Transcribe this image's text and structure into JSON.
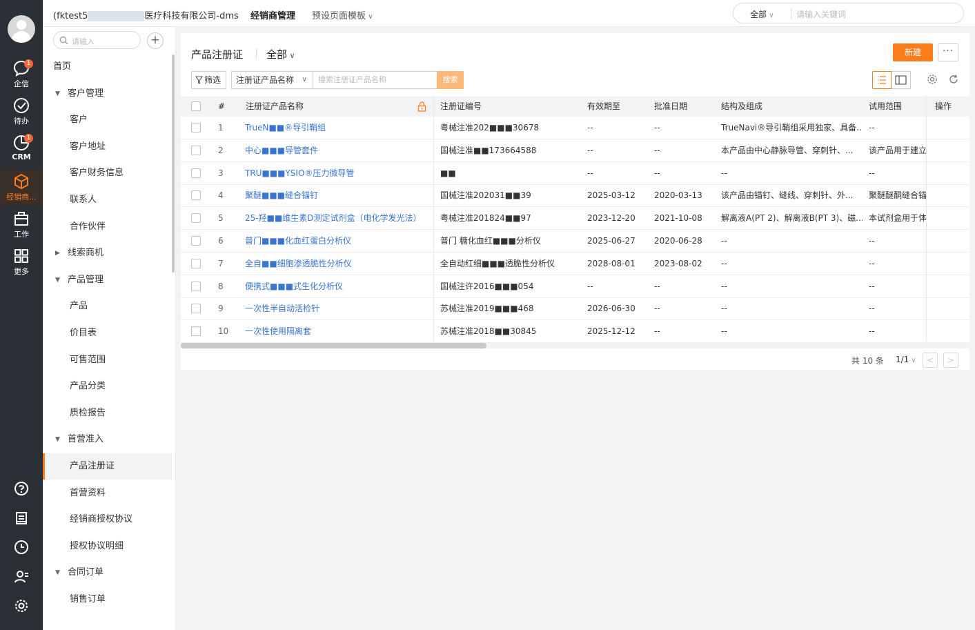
{
  "rail": {
    "items": [
      {
        "label": "企信",
        "badge": "1"
      },
      {
        "label": "待办",
        "badge": ""
      },
      {
        "label": "CRM",
        "badge": "1"
      },
      {
        "label": "经销商...",
        "badge": ""
      },
      {
        "label": "工作",
        "badge": ""
      },
      {
        "label": "更多",
        "badge": ""
      }
    ],
    "bottom_icons": [
      "help-icon",
      "report-icon",
      "clock-icon",
      "contacts-icon",
      "settings-icon"
    ]
  },
  "topbar": {
    "company_prefix": "(fktest5",
    "company_hidden": "■■■■■■",
    "company_suffix": "医疗科技有限公司-dms",
    "nav_active": "经销商管理",
    "nav_template": "预设页面模板",
    "search_scope": "全部",
    "search_placeholder": "请输入关键词"
  },
  "sidebar": {
    "search_placeholder": "请输入",
    "add_label": "+",
    "items": [
      {
        "label": "首页",
        "level": 0
      },
      {
        "label": "客户管理",
        "level": 1,
        "caret": "▼"
      },
      {
        "label": "客户",
        "level": 2
      },
      {
        "label": "客户地址",
        "level": 2
      },
      {
        "label": "客户财务信息",
        "level": 2
      },
      {
        "label": "联系人",
        "level": 2
      },
      {
        "label": "合作伙伴",
        "level": 2
      },
      {
        "label": "线索商机",
        "level": 1,
        "caret": "▶"
      },
      {
        "label": "产品管理",
        "level": 1,
        "caret": "▼"
      },
      {
        "label": "产品",
        "level": 2
      },
      {
        "label": "价目表",
        "level": 2
      },
      {
        "label": "可售范围",
        "level": 2
      },
      {
        "label": "产品分类",
        "level": 2
      },
      {
        "label": "质检报告",
        "level": 2
      },
      {
        "label": "首营准入",
        "level": 1,
        "caret": "▼"
      },
      {
        "label": "产品注册证",
        "level": 2,
        "active": true
      },
      {
        "label": "首营资料",
        "level": 2
      },
      {
        "label": "经销商授权协议",
        "level": 2
      },
      {
        "label": "授权协议明细",
        "level": 2
      },
      {
        "label": "合同订单",
        "level": 1,
        "caret": "▼"
      },
      {
        "label": "销售订单",
        "level": 2
      }
    ]
  },
  "main": {
    "title": "产品注册证",
    "scope": "全部",
    "new_button": "新建",
    "more_button": "···",
    "filter_button": "筛选",
    "field_select": "注册证产品名称",
    "search_placeholder": "搜索注册证产品名称",
    "search_button": "搜索",
    "columns": [
      "#",
      "注册证产品名称",
      "注册证编号",
      "有效期至",
      "批准日期",
      "结构及组成",
      "试用范围",
      "操作"
    ],
    "rows": [
      {
        "idx": "1",
        "name": "TrueN■■®导引鞘组",
        "code": "粤械注准202■■■30678",
        "valid": "--",
        "approved": "--",
        "structure": "TrueNavi®导引鞘组采用独家、具备...",
        "scope": "--"
      },
      {
        "idx": "2",
        "name": "中心■■■导管套件",
        "code": "国械注准■■173664588",
        "valid": "--",
        "approved": "--",
        "structure": "本产品由中心静脉导管、穿刺针、...",
        "scope": "该产品用于建立..."
      },
      {
        "idx": "3",
        "name": "TRU■■■YSIO®压力微导管",
        "code": "■■",
        "valid": "--",
        "approved": "--",
        "structure": "--",
        "scope": "--"
      },
      {
        "idx": "4",
        "name": "聚醚■■■缝合锚钉",
        "code": "国械注准202031■■39",
        "valid": "2025-03-12",
        "approved": "2020-03-13",
        "structure": "该产品由锚钉、缝线、穿刺针、外...",
        "scope": "聚醚醚酮缝合锚钉..."
      },
      {
        "idx": "5",
        "name": "25-羟■■维生素D测定试剂盒（电化学发光法）",
        "code": "粤械注准201824■■97",
        "valid": "2023-12-20",
        "approved": "2021-10-08",
        "structure": "解离液A(PT 2)、解离液B(PT 3)、磁...",
        "scope": "本试剂盒用于体外..."
      },
      {
        "idx": "6",
        "name": "普门■■■化血红蛋白分析仪",
        "code": "普门 糖化血红■■■分析仪",
        "valid": "2025-06-27",
        "approved": "2020-06-28",
        "structure": "--",
        "scope": "--"
      },
      {
        "idx": "7",
        "name": "全自■■细胞渗透脆性分析仪",
        "code": "全自动红细■■■透脆性分析仪",
        "valid": "2028-08-01",
        "approved": "2023-08-02",
        "structure": "--",
        "scope": "--"
      },
      {
        "idx": "8",
        "name": "便携式■■■式生化分析仪",
        "code": "国械注许2016■■■054",
        "valid": "--",
        "approved": "--",
        "structure": "--",
        "scope": "--"
      },
      {
        "idx": "9",
        "name": "一次性半自动活检针",
        "code": "苏械注准2019■■■468",
        "valid": "2026-06-30",
        "approved": "--",
        "structure": "--",
        "scope": "--"
      },
      {
        "idx": "10",
        "name": "一次性使用隔离套",
        "code": "苏械注准2018■■30845",
        "valid": "2025-12-12",
        "approved": "--",
        "structure": "--",
        "scope": "--"
      }
    ],
    "pager_total": "共 10 条",
    "pager_page": "1/1",
    "pager_prev": "<",
    "pager_next": ">"
  },
  "colors": {
    "accent": "#fa7d19",
    "link": "#3874d0",
    "rail": "#2b2f36"
  }
}
